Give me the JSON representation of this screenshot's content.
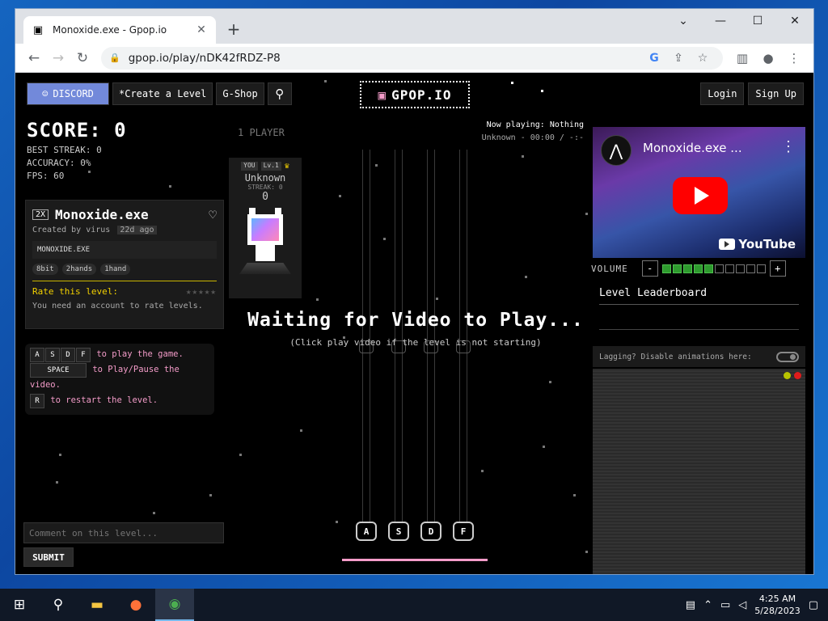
{
  "browser": {
    "tab_title": "Monoxide.exe - Gpop.io",
    "url": "gpop.io/play/nDK42fRDZ-P8"
  },
  "nav": {
    "discord": "DISCORD",
    "create": "*Create a Level",
    "shop": "G-Shop",
    "logo": "GPOP.IO",
    "login": "Login",
    "signup": "Sign Up"
  },
  "stats": {
    "score": "SCORE: 0",
    "best_streak": "BEST STREAK: 0",
    "accuracy": "ACCURACY: 0%",
    "fps": "FPS: 60"
  },
  "level": {
    "speed": "2X",
    "name": "Monoxide.exe",
    "created_by": "Created by virus",
    "created_ago": "22d ago",
    "description": "MONOXIDE.EXE",
    "tags": [
      "8bit",
      "2hands",
      "1hand"
    ],
    "rate_label": "Rate this level:",
    "rate_stars": "★★★★★",
    "rate_note": "You need an account to rate levels."
  },
  "controls": {
    "keys": [
      "A",
      "S",
      "D",
      "F"
    ],
    "play_text": "to play the game.",
    "space_key": "SPACE",
    "pause_text": "to Play/Pause the video.",
    "restart_key": "R",
    "restart_text": "to restart the level."
  },
  "comment": {
    "placeholder": "Comment on this level...",
    "submit": "SUBMIT"
  },
  "player": {
    "count_label": "1 PLAYER",
    "you": "YOU",
    "level": "Lv.1",
    "name": "Unknown",
    "streak": "STREAK: 0",
    "score": "0"
  },
  "now_playing": {
    "line1": "Now playing: Nothing",
    "line2": "Unknown - 00:00 / -:-"
  },
  "game": {
    "waiting": "Waiting for Video to Play...",
    "waiting_sub": "(Click play video if the level is not starting)",
    "lane_keys": [
      "A",
      "S",
      "D",
      "F"
    ]
  },
  "video": {
    "title": "Monoxide.exe ...",
    "brand": "YouTube"
  },
  "volume": {
    "label": "VOLUME",
    "minus": "-",
    "plus": "+",
    "level": 5,
    "max": 10
  },
  "leaderboard": {
    "title": "Level Leaderboard"
  },
  "lag": {
    "text": "Lagging? Disable animations here:"
  },
  "chat": {
    "dot_colors": [
      "#b8c400",
      "#e01b1b"
    ]
  },
  "taskbar": {
    "time": "4:25 AM",
    "date": "5/28/2023"
  }
}
